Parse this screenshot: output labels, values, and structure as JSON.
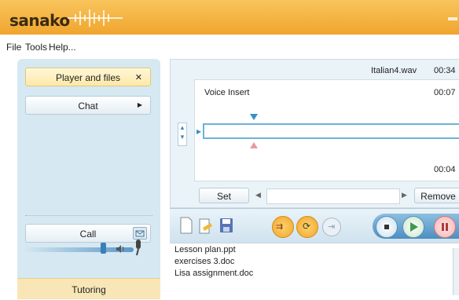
{
  "app": {
    "logo": "sanako",
    "brand_color": "#f0a52e"
  },
  "menu": [
    "File",
    "Tools",
    "Help..."
  ],
  "left": {
    "player_label": "Player and files",
    "player_close": "✕",
    "chat_label": "Chat",
    "chat_arrow": "▶",
    "call_label": "Call",
    "tutoring_label": "Tutoring"
  },
  "player": {
    "filename": "Italian4.wav",
    "file_time": "00:34",
    "insert_label": "Voice Insert",
    "insert_time": "00:07",
    "bottom_time": "00:04",
    "set_label": "Set",
    "remove_label": "Remove",
    "left_arrow": "◀",
    "right_arrow": "▶"
  },
  "files": [
    "Lesson plan.ppt",
    "exercises 3.doc",
    "Lisa assignment.doc"
  ],
  "icons": {
    "new": "new-document-icon",
    "open": "open-folder-icon",
    "save": "save-icon",
    "repeat1": "repeat-ab-icon",
    "repeat2": "loop-icon",
    "exit": "export-icon",
    "stop": "stop-icon",
    "play": "play-icon",
    "pause": "pause-icon",
    "mail": "envelope-icon",
    "speaker": "speaker-icon",
    "mic": "microphone-icon"
  }
}
